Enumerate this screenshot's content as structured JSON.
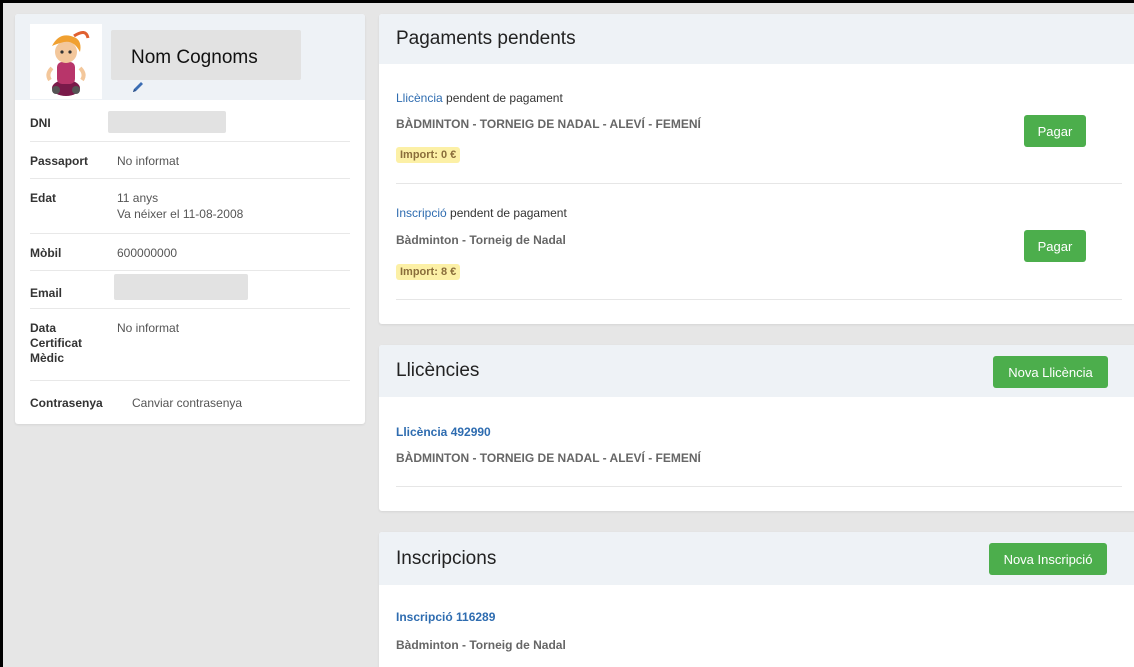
{
  "profile": {
    "name": "Nom Cognoms",
    "fields": [
      {
        "label": "DNI",
        "value": ""
      },
      {
        "label": "Passaport",
        "value": "No informat"
      },
      {
        "label": "Edat",
        "value_line1": "11 anys",
        "value_line2": "Va néixer el 11-08-2008"
      },
      {
        "label": "Mòbil",
        "value": "600000000"
      },
      {
        "label": "Email",
        "value": ""
      },
      {
        "label_line1": "Data",
        "label_line2": "Certificat",
        "label_line3": "Mèdic",
        "value": "No informat"
      },
      {
        "label": "Contrasenya",
        "link": "Canviar contrasenya"
      }
    ]
  },
  "pending": {
    "title": "Pagaments pendents",
    "items": [
      {
        "link": "Llicència",
        "suffix": " pendent de pagament",
        "name": "BÀDMINTON - TORNEIG DE NADAL - ALEVÍ - FEMENÍ",
        "amount": "Import: 0 €",
        "button": "Pagar"
      },
      {
        "link": "Inscripció",
        "suffix": " pendent de pagament",
        "name": "Bàdminton - Torneig de Nadal",
        "amount": "Import: 8 €",
        "button": "Pagar"
      }
    ]
  },
  "licences": {
    "title": "Llicències",
    "button": "Nova Llicència",
    "items": [
      {
        "link": "Llicència 492990",
        "name": "BÀDMINTON - TORNEIG DE NADAL - ALEVÍ - FEMENÍ"
      }
    ]
  },
  "inscriptions": {
    "title": "Inscripcions",
    "button": "Nova Inscripció",
    "items": [
      {
        "link": "Inscripció 116289",
        "name": "Bàdminton - Torneig de Nadal"
      }
    ]
  },
  "colors": {
    "accent_link": "#2e6cb0",
    "button_green": "#4cae4c",
    "badge_yellow": "#fcf0a6"
  }
}
